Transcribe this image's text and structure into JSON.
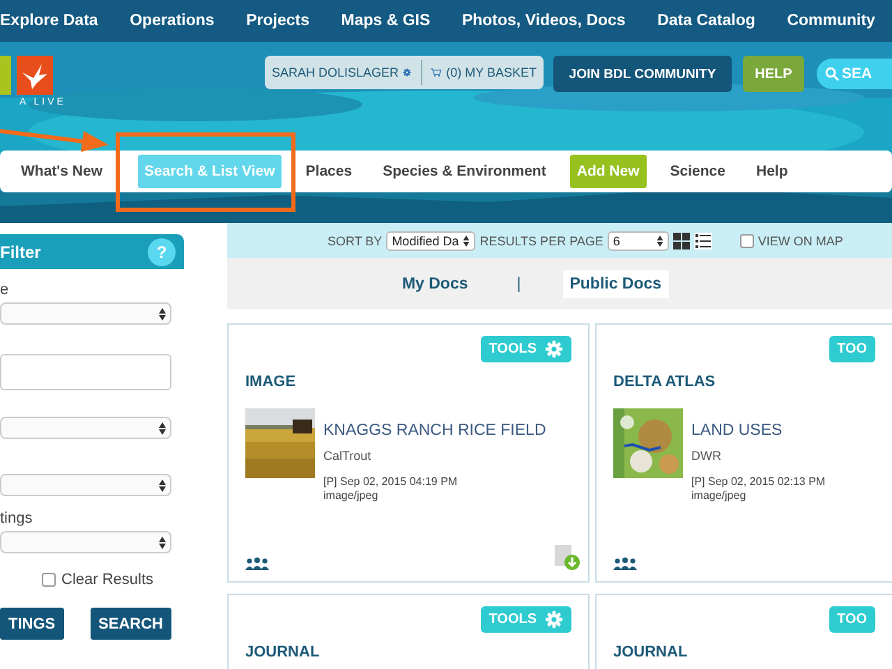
{
  "top_nav": [
    {
      "label": "Explore Data"
    },
    {
      "label": "Operations"
    },
    {
      "label": "Projects"
    },
    {
      "label": "Maps & GIS"
    },
    {
      "label": "Photos, Videos, Docs"
    },
    {
      "label": "Data Catalog"
    },
    {
      "label": "Community"
    }
  ],
  "logo": {
    "text": "A LIVE"
  },
  "user_bar": {
    "user": "SARAH DOLISLAGER",
    "basket": "(0) MY BASKET"
  },
  "join_button": "JOIN BDL COMMUNITY",
  "help_button": "HELP",
  "search_button": "SEA",
  "main_nav": [
    {
      "label": "What's New",
      "kind": "link",
      "selected": false
    },
    {
      "label": "Search & List View",
      "kind": "link",
      "selected": true
    },
    {
      "label": "Places",
      "kind": "link",
      "selected": false
    },
    {
      "label": "Species & Environment",
      "kind": "link",
      "selected": false
    },
    {
      "label": "Add New",
      "kind": "accent",
      "selected": false
    },
    {
      "label": "Science",
      "kind": "link",
      "selected": false
    },
    {
      "label": "Help",
      "kind": "link",
      "selected": false
    }
  ],
  "sidebar": {
    "title": "Filter",
    "help": "?",
    "fields": [
      {
        "label": "e",
        "kind": "select"
      },
      {
        "kind": "input"
      },
      {
        "kind": "select"
      },
      {
        "kind": "select"
      },
      {
        "label": "tings",
        "kind": "select"
      }
    ],
    "clear_results": {
      "label": "Clear Results",
      "checked": false
    },
    "buttons": [
      "TINGS",
      "SEARCH"
    ]
  },
  "toolbar": {
    "sort_label": "SORT BY",
    "sort_value": "Modified Da",
    "per_page_label": "RESULTS PER PAGE",
    "per_page_value": "6",
    "view_on_map": {
      "label": "VIEW ON MAP",
      "checked": false
    }
  },
  "doc_tabs": [
    {
      "label": "My Docs",
      "selected": false
    },
    {
      "label": "Public Docs",
      "selected": true
    }
  ],
  "doc_tab_separator": "|",
  "cards": [
    {
      "tools": "TOOLS",
      "category": "IMAGE",
      "title": "KNAGGS RANCH RICE FIELD",
      "source": "CalTrout",
      "date": "[P] Sep 02, 2015 04:19 PM",
      "mime": "image/jpeg",
      "download": true
    },
    {
      "tools": "TOO",
      "category": "DELTA ATLAS",
      "title": "LAND USES",
      "source": "DWR",
      "date": "[P] Sep 02, 2015 02:13 PM",
      "mime": "image/jpeg",
      "download": false
    },
    {
      "tools": "TOOLS",
      "category": "JOURNAL"
    },
    {
      "tools": "TOO",
      "category": "JOURNAL"
    }
  ]
}
